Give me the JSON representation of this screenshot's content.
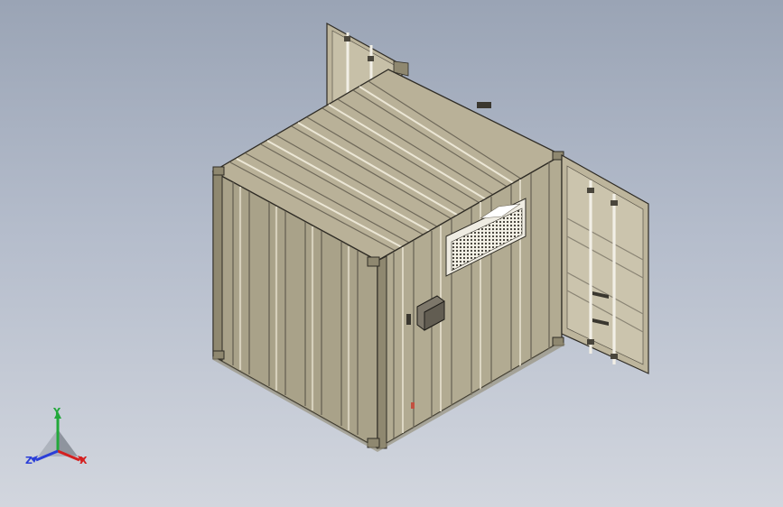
{
  "viewport": {
    "background_top": "#9aa4b5",
    "background_bottom": "#d2d6de",
    "model_color": "#b8b096",
    "model_shadow_color": "#8f8870",
    "edge_color": "#2f2c25"
  },
  "model": {
    "type": "shipping-container",
    "doors": "open",
    "features": [
      "corrugated-roof",
      "corrugated-side-walls",
      "louvered-vent",
      "electrical-box",
      "open-double-doors"
    ]
  },
  "triad": {
    "x_label": "X",
    "y_label": "Y",
    "z_label": "Z",
    "x_color": "#d42020",
    "y_color": "#22a83a",
    "z_color": "#2a3ed8"
  }
}
